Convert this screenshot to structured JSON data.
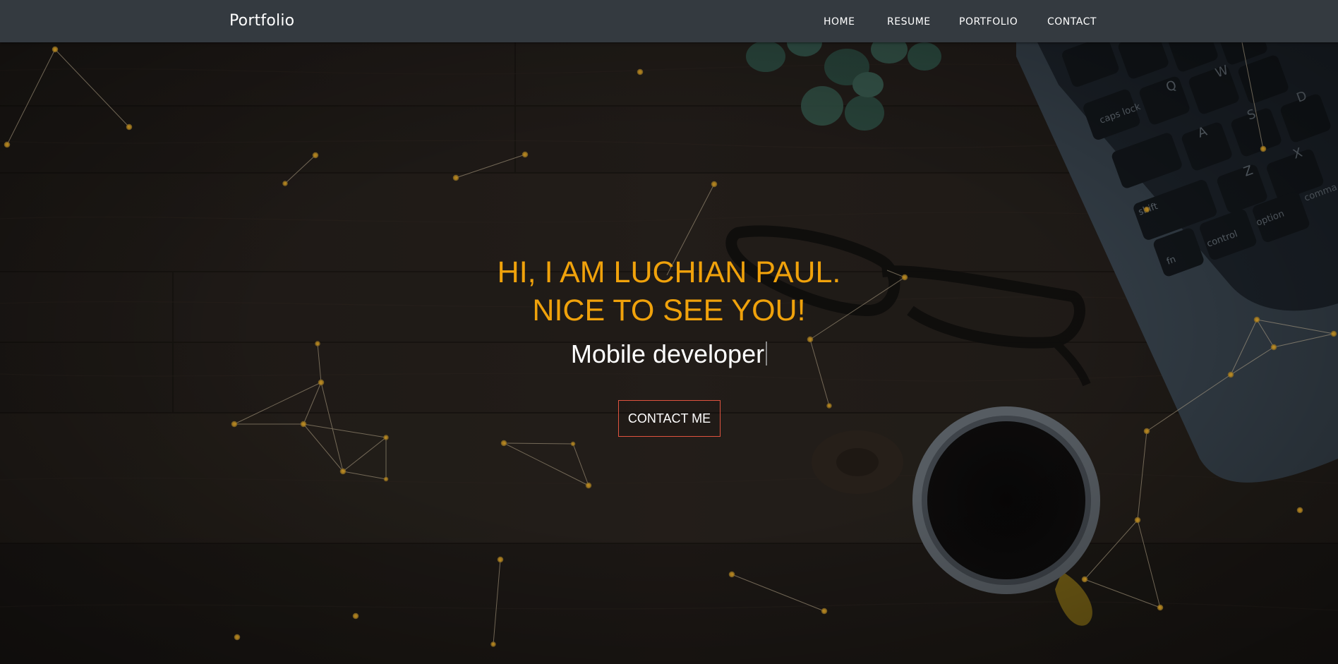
{
  "navbar": {
    "brand": "Portfolio",
    "links": [
      {
        "label": "HOME"
      },
      {
        "label": "RESUME"
      },
      {
        "label": "PORTFOLIO"
      },
      {
        "label": "CONTACT"
      }
    ]
  },
  "hero": {
    "title_line1": "HI, I AM LUCHIAN PAUL.",
    "title_line2": "NICE TO SEE YOU!",
    "typed_text": "Mobile developer",
    "cta_label": "CONTACT ME"
  },
  "colors": {
    "navbar_bg": "#343a40",
    "accent": "#f0a20b",
    "cta_border": "#e0533f"
  }
}
